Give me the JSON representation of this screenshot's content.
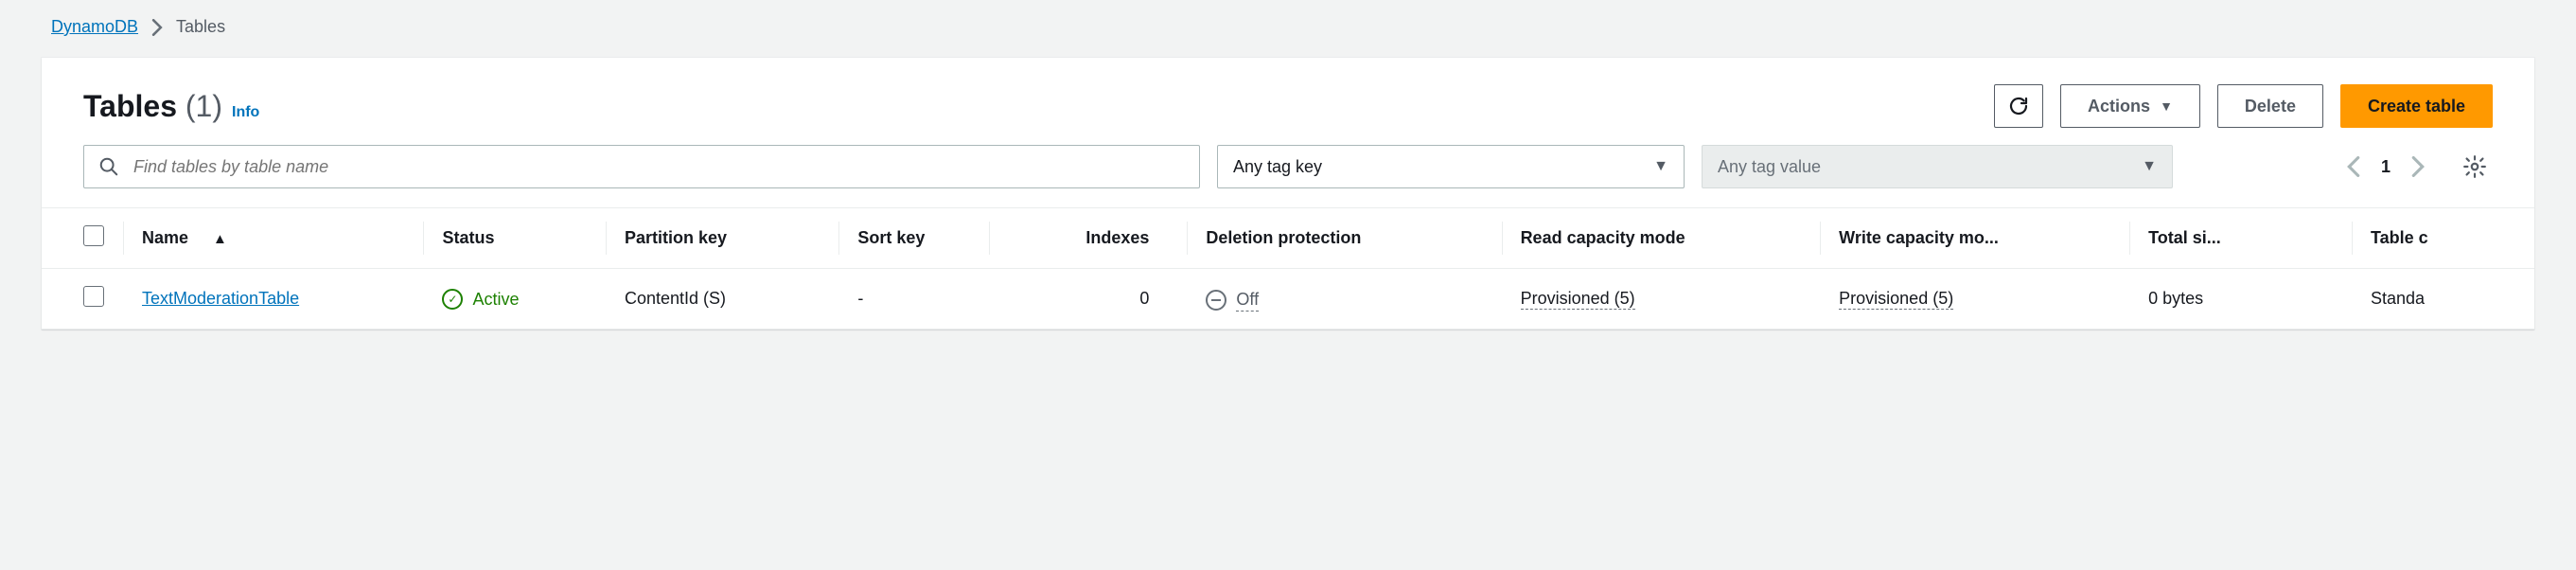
{
  "breadcrumb": {
    "root": "DynamoDB",
    "current": "Tables"
  },
  "header": {
    "title": "Tables",
    "count": "(1)",
    "info": "Info"
  },
  "actions": {
    "actions_label": "Actions",
    "delete_label": "Delete",
    "create_label": "Create table"
  },
  "filters": {
    "search_placeholder": "Find tables by table name",
    "tag_key_label": "Any tag key",
    "tag_value_label": "Any tag value"
  },
  "pager": {
    "page": "1"
  },
  "columns": {
    "name": "Name",
    "status": "Status",
    "partition_key": "Partition key",
    "sort_key": "Sort key",
    "indexes": "Indexes",
    "deletion_protection": "Deletion protection",
    "read_capacity": "Read capacity mode",
    "write_capacity": "Write capacity mo...",
    "total_size": "Total si...",
    "table_class": "Table c"
  },
  "rows": [
    {
      "name": "TextModerationTable",
      "status": "Active",
      "partition_key": "ContentId (S)",
      "sort_key": "-",
      "indexes": "0",
      "deletion_protection": "Off",
      "read_capacity": "Provisioned (5)",
      "write_capacity": "Provisioned (5)",
      "total_size": "0 bytes",
      "table_class": "Standa"
    }
  ]
}
